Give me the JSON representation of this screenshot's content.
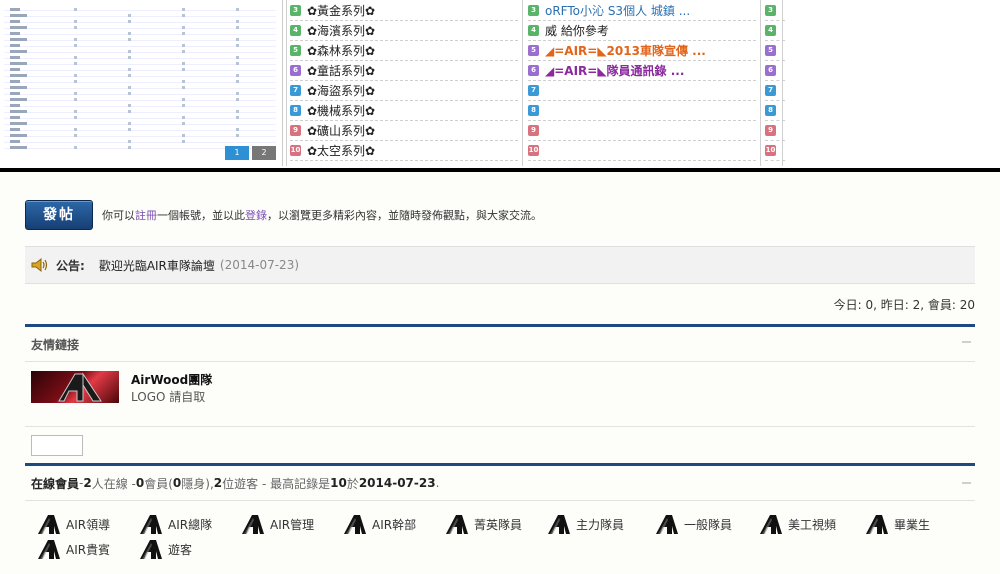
{
  "topics": {
    "col1": [
      {
        "num": "3",
        "color": "green",
        "text": "✿黃金系列✿"
      },
      {
        "num": "4",
        "color": "green",
        "text": "✿海濱系列✿"
      },
      {
        "num": "5",
        "color": "green",
        "text": "✿森林系列✿"
      },
      {
        "num": "6",
        "color": "purple",
        "text": "✿童話系列✿"
      },
      {
        "num": "7",
        "color": "blue",
        "text": "✿海盜系列✿"
      },
      {
        "num": "8",
        "color": "blue",
        "text": "✿機械系列✿"
      },
      {
        "num": "9",
        "color": "red",
        "text": "✿礦山系列✿"
      },
      {
        "num": "10",
        "color": "red",
        "text": "✿太空系列✿"
      }
    ],
    "col2": [
      {
        "num": "3",
        "color": "green",
        "text": "oRFTo小沁 S3個人 城鎮 ...",
        "style": "blue"
      },
      {
        "num": "4",
        "color": "green",
        "text": "威 給你參考",
        "style": "plain"
      },
      {
        "num": "5",
        "color": "purple",
        "text": "◢=AIR=◣2013車隊宣傳 ...",
        "style": "orange"
      },
      {
        "num": "6",
        "color": "purple",
        "text": "◢=AIR=◣隊員通訊錄 ...",
        "style": "violet"
      },
      {
        "num": "7",
        "color": "blue",
        "text": "",
        "style": "plain"
      },
      {
        "num": "8",
        "color": "blue",
        "text": "",
        "style": "plain"
      },
      {
        "num": "9",
        "color": "red",
        "text": "",
        "style": "plain"
      },
      {
        "num": "10",
        "color": "red",
        "text": "",
        "style": "plain"
      }
    ],
    "col3": [
      {
        "num": "3",
        "color": "green"
      },
      {
        "num": "4",
        "color": "green"
      },
      {
        "num": "5",
        "color": "purple"
      },
      {
        "num": "6",
        "color": "purple"
      },
      {
        "num": "7",
        "color": "blue"
      },
      {
        "num": "8",
        "color": "blue"
      },
      {
        "num": "9",
        "color": "red"
      },
      {
        "num": "10",
        "color": "red"
      }
    ],
    "pager": [
      "1",
      "2"
    ]
  },
  "post": {
    "button_label": "發帖",
    "invite_prefix": "你可以",
    "register_link": "註冊",
    "invite_mid1": "一個帳號，並以此",
    "login_link": "登錄",
    "invite_suffix": "，以瀏覽更多精彩內容，並隨時發佈觀點，與大家交流。"
  },
  "notice": {
    "label": "公告:",
    "text": "歡迎光臨AIR車隊論壇",
    "date": "(2014-07-23)"
  },
  "stats": {
    "text": "今日: 0, 昨日: 2, 會員: 20"
  },
  "links": {
    "title": "友情鏈接",
    "item_name": "AirWood團隊",
    "item_desc": "LOGO 請自取"
  },
  "online": {
    "label": "在線會員",
    "sep1": " - ",
    "online_count": "2",
    "text1": " 人在線 - ",
    "member_count": "0",
    "text2": " 會員(",
    "hidden_count": "0",
    "text3": " 隱身), ",
    "guest_count": "2",
    "text4": " 位遊客 - 最高記錄是 ",
    "record_count": "10",
    "text5": " 於 ",
    "record_date": "2014-07-23",
    "text6": "."
  },
  "member_groups": [
    "AIR領導",
    "AIR總隊",
    "AIR管理",
    "AIR幹部",
    "菁英隊員",
    "主力隊員",
    "一般隊員",
    "美工視頻",
    "畢業生",
    "AIR貴賓",
    "遊客"
  ],
  "colors": {
    "accent": "#1f4a7f",
    "link_violet": "#7a4fb3",
    "topic_blue": "#2a6fb0",
    "topic_orange": "#e2651a",
    "topic_violet": "#8a2b9c"
  }
}
